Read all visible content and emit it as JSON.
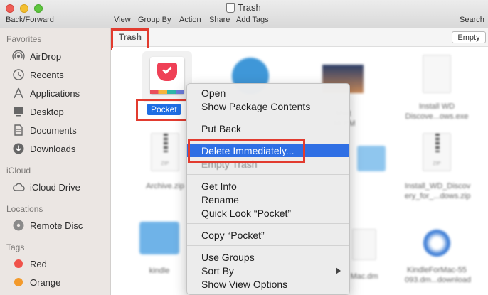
{
  "window": {
    "title": "Trash"
  },
  "toolbar": {
    "back_forward": "Back/Forward",
    "view": "View",
    "group_by": "Group By",
    "action": "Action",
    "share": "Share",
    "add_tags": "Add Tags",
    "search": "Search"
  },
  "sidebar": {
    "favorites_header": "Favorites",
    "favorites": [
      "AirDrop",
      "Recents",
      "Applications",
      "Desktop",
      "Documents",
      "Downloads"
    ],
    "icloud_header": "iCloud",
    "icloud": [
      "iCloud Drive"
    ],
    "locations_header": "Locations",
    "locations": [
      "Remote Disc"
    ],
    "tags_header": "Tags",
    "tags": [
      {
        "label": "Red",
        "color": "#f0524a"
      },
      {
        "label": "Orange",
        "color": "#f39a2b"
      }
    ]
  },
  "pathbar": {
    "title": "Trash",
    "empty_button": "Empty"
  },
  "files": {
    "selected": "Pocket",
    "items": [
      "Shot\n.46 PM",
      "Install WD\nDiscove...ows.exe",
      "Archive.zip",
      "Install_WD_Discov\nery_for_...dows.zip",
      "kindle",
      "Mac.dm",
      "KindleForMac-55\n093.dm...download"
    ]
  },
  "context_menu": {
    "open": "Open",
    "show_package_contents": "Show Package Contents",
    "put_back": "Put Back",
    "delete_immediately": "Delete Immediately...",
    "empty_trash": "Empty Trash",
    "get_info": "Get Info",
    "rename": "Rename",
    "quick_look": "Quick Look “Pocket”",
    "copy": "Copy “Pocket”",
    "use_groups": "Use Groups",
    "sort_by": "Sort By",
    "show_view_options": "Show View Options"
  },
  "colors": {
    "selection": "#2f6fe4",
    "highlight": "#e23b2f",
    "pocket": "#ef4056"
  }
}
